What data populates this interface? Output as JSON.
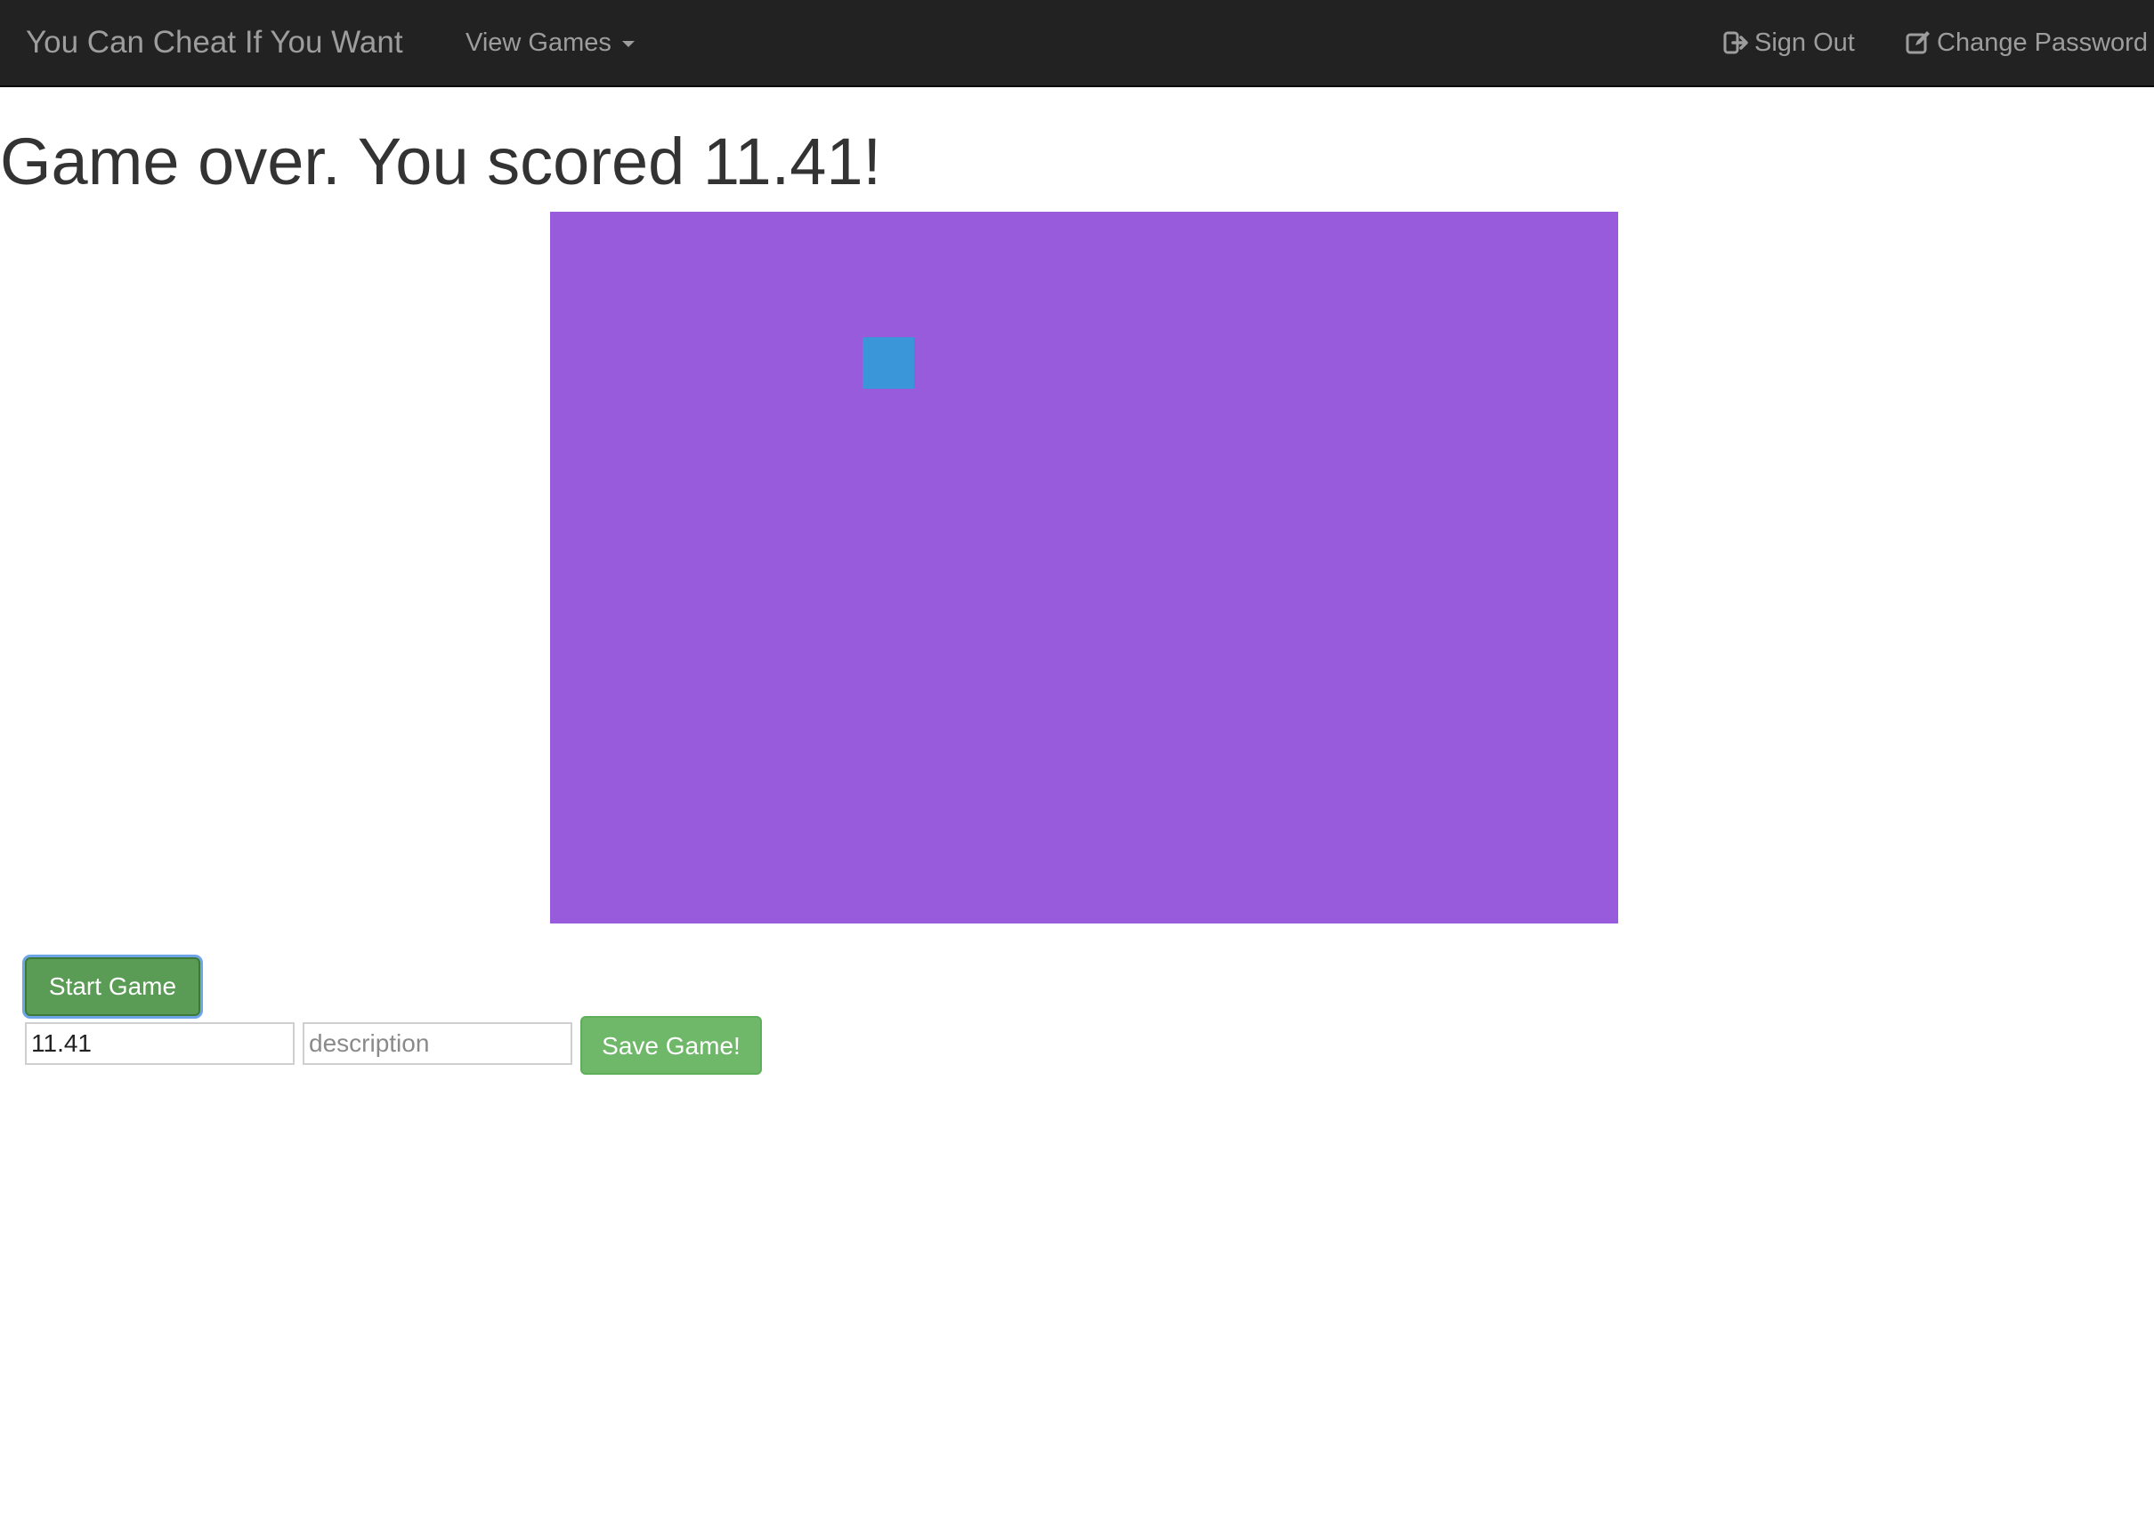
{
  "navbar": {
    "brand": "You Can Cheat If You Want",
    "view_games": "View Games",
    "sign_out": "Sign Out",
    "change_password": "Change Password"
  },
  "main": {
    "title": "Game over. You scored 11.41!",
    "start_button": "Start Game",
    "score_value": "11.41",
    "description_placeholder": "description",
    "save_button": "Save Game!"
  },
  "colors": {
    "navbar_bg": "#222222",
    "canvas_bg": "#975bdc",
    "player_square": "#3a96d9",
    "start_button_bg": "#5a9c55",
    "save_button_bg": "#6fb86a"
  }
}
